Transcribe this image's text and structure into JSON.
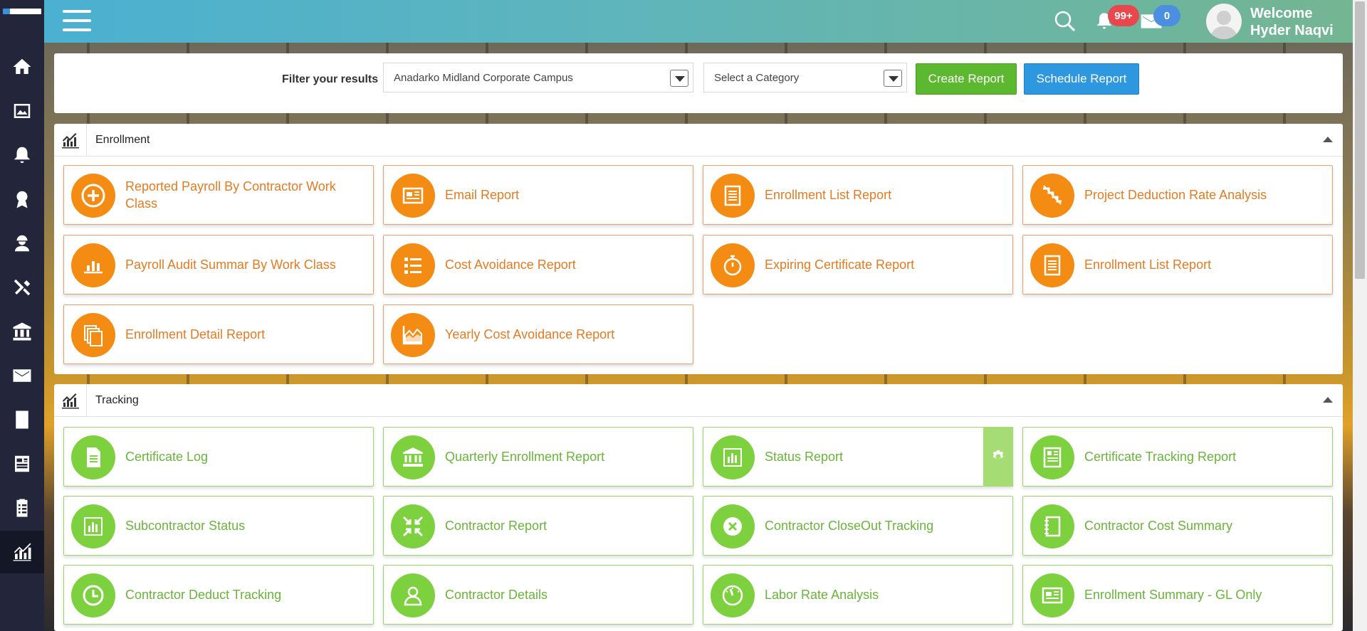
{
  "header": {
    "welcome_line1": "Welcome",
    "welcome_line2": "Hyder Naqvi",
    "notifications_count": "99+",
    "messages_count": "0"
  },
  "sidebar": {
    "items": [
      {
        "icon": "home-icon"
      },
      {
        "icon": "dashboard-icon"
      },
      {
        "icon": "bell-icon"
      },
      {
        "icon": "award-icon"
      },
      {
        "icon": "worker-icon"
      },
      {
        "icon": "tools-icon"
      },
      {
        "icon": "bank-icon"
      },
      {
        "icon": "mail-icon"
      },
      {
        "icon": "document-icon"
      },
      {
        "icon": "report-icon"
      },
      {
        "icon": "checklist-icon"
      },
      {
        "icon": "analytics-icon",
        "active": true
      }
    ]
  },
  "filter": {
    "label": "Filter your results",
    "campus_value": "Anadarko Midland Corporate Campus",
    "category_placeholder": "Select a Category",
    "create_label": "Create Report",
    "schedule_label": "Schedule Report"
  },
  "enrollment": {
    "title": "Enrollment",
    "cards": [
      {
        "label": "Reported Payroll By Contractor Work Class",
        "icon": "plus-circle-icon"
      },
      {
        "label": "Email Report",
        "icon": "newspaper-icon"
      },
      {
        "label": "Enrollment List Report",
        "icon": "list-doc-icon"
      },
      {
        "label": "Project Deduction Rate Analysis",
        "icon": "stairs-icon"
      },
      {
        "label": "Payroll Audit Summar By Work Class",
        "icon": "bar-chart-icon"
      },
      {
        "label": "Cost Avoidance Report",
        "icon": "list-icon"
      },
      {
        "label": "Expiring Certificate Report",
        "icon": "stopwatch-icon"
      },
      {
        "label": "Enrollment List Report",
        "icon": "list-doc-icon"
      },
      {
        "label": "Enrollment Detail Report",
        "icon": "copy-icon"
      },
      {
        "label": "Yearly Cost Avoidance Report",
        "icon": "area-chart-icon"
      }
    ]
  },
  "tracking": {
    "title": "Tracking",
    "cards": [
      {
        "label": "Certificate Log",
        "icon": "file-icon"
      },
      {
        "label": "Quarterly Enrollment Report",
        "icon": "bank-icon"
      },
      {
        "label": "Status Report",
        "icon": "chart-frame-icon"
      },
      {
        "label": "Certificate Tracking Report",
        "icon": "doc-card-icon"
      },
      {
        "label": "Subcontractor Status",
        "icon": "chart-frame-icon"
      },
      {
        "label": "Contractor Report",
        "icon": "compress-icon"
      },
      {
        "label": "Contractor CloseOut Tracking",
        "icon": "close-circle-icon"
      },
      {
        "label": "Contractor Cost Summary",
        "icon": "notebook-icon"
      },
      {
        "label": "Contractor Deduct Tracking",
        "icon": "clock-icon"
      },
      {
        "label": "Contractor Details",
        "icon": "user-icon"
      },
      {
        "label": "Labor Rate Analysis",
        "icon": "gauge-icon"
      },
      {
        "label": "Enrollment Summary - GL Only",
        "icon": "newspaper-icon"
      }
    ]
  },
  "colors": {
    "orange": "#f48b12",
    "green": "#7ed13e",
    "create_button": "#5cb82f",
    "schedule_button": "#2d97e0"
  }
}
